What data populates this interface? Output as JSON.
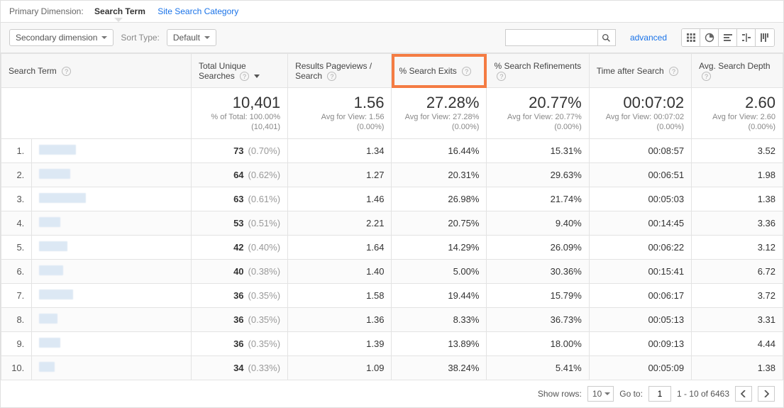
{
  "primary_dimension": {
    "label": "Primary Dimension:",
    "active": "Search Term",
    "alt": "Site Search Category"
  },
  "toolbar": {
    "secondary_dimension": "Secondary dimension",
    "sort_type_label": "Sort Type:",
    "sort_type_value": "Default",
    "advanced": "advanced"
  },
  "columns": {
    "c0": "Search Term",
    "c1": "Total Unique Searches",
    "c2": "Results Pageviews / Search",
    "c3": "% Search Exits",
    "c4": "% Search Refinements",
    "c5": "Time after Search",
    "c6": "Avg. Search Depth"
  },
  "totals": {
    "c1_big": "10,401",
    "c1_sub1": "% of Total: 100.00%",
    "c1_sub2": "(10,401)",
    "c2_big": "1.56",
    "c2_sub": "Avg for View: 1.56 (0.00%)",
    "c3_big": "27.28%",
    "c3_sub1": "Avg for View: 27.28%",
    "c3_sub2": "(0.00%)",
    "c4_big": "20.77%",
    "c4_sub1": "Avg for View: 20.77%",
    "c4_sub2": "(0.00%)",
    "c5_big": "00:07:02",
    "c5_sub1": "Avg for View: 00:07:02",
    "c5_sub2": "(0.00%)",
    "c6_big": "2.60",
    "c6_sub1": "Avg for View: 2.60",
    "c6_sub2": "(0.00%)"
  },
  "rows": [
    {
      "idx": "1.",
      "uniq": "73",
      "pct": "(0.70%)",
      "rpv": "1.34",
      "exits": "16.44%",
      "refine": "15.31%",
      "time": "00:08:57",
      "depth": "3.52",
      "rw": 52
    },
    {
      "idx": "2.",
      "uniq": "64",
      "pct": "(0.62%)",
      "rpv": "1.27",
      "exits": "20.31%",
      "refine": "29.63%",
      "time": "00:06:51",
      "depth": "1.98",
      "rw": 44
    },
    {
      "idx": "3.",
      "uniq": "63",
      "pct": "(0.61%)",
      "rpv": "1.46",
      "exits": "26.98%",
      "refine": "21.74%",
      "time": "00:05:03",
      "depth": "1.38",
      "rw": 66
    },
    {
      "idx": "4.",
      "uniq": "53",
      "pct": "(0.51%)",
      "rpv": "2.21",
      "exits": "20.75%",
      "refine": "9.40%",
      "time": "00:14:45",
      "depth": "3.36",
      "rw": 30
    },
    {
      "idx": "5.",
      "uniq": "42",
      "pct": "(0.40%)",
      "rpv": "1.64",
      "exits": "14.29%",
      "refine": "26.09%",
      "time": "00:06:22",
      "depth": "3.12",
      "rw": 40
    },
    {
      "idx": "6.",
      "uniq": "40",
      "pct": "(0.38%)",
      "rpv": "1.40",
      "exits": "5.00%",
      "refine": "30.36%",
      "time": "00:15:41",
      "depth": "6.72",
      "rw": 34
    },
    {
      "idx": "7.",
      "uniq": "36",
      "pct": "(0.35%)",
      "rpv": "1.58",
      "exits": "19.44%",
      "refine": "15.79%",
      "time": "00:06:17",
      "depth": "3.72",
      "rw": 48
    },
    {
      "idx": "8.",
      "uniq": "36",
      "pct": "(0.35%)",
      "rpv": "1.36",
      "exits": "8.33%",
      "refine": "36.73%",
      "time": "00:05:13",
      "depth": "3.31",
      "rw": 26
    },
    {
      "idx": "9.",
      "uniq": "36",
      "pct": "(0.35%)",
      "rpv": "1.39",
      "exits": "13.89%",
      "refine": "18.00%",
      "time": "00:09:13",
      "depth": "4.44",
      "rw": 30
    },
    {
      "idx": "10.",
      "uniq": "34",
      "pct": "(0.33%)",
      "rpv": "1.09",
      "exits": "38.24%",
      "refine": "5.41%",
      "time": "00:05:09",
      "depth": "1.38",
      "rw": 22
    }
  ],
  "pager": {
    "show_rows_label": "Show rows:",
    "show_rows_value": "10",
    "goto_label": "Go to:",
    "goto_value": "1",
    "range": "1 - 10 of 6463"
  }
}
